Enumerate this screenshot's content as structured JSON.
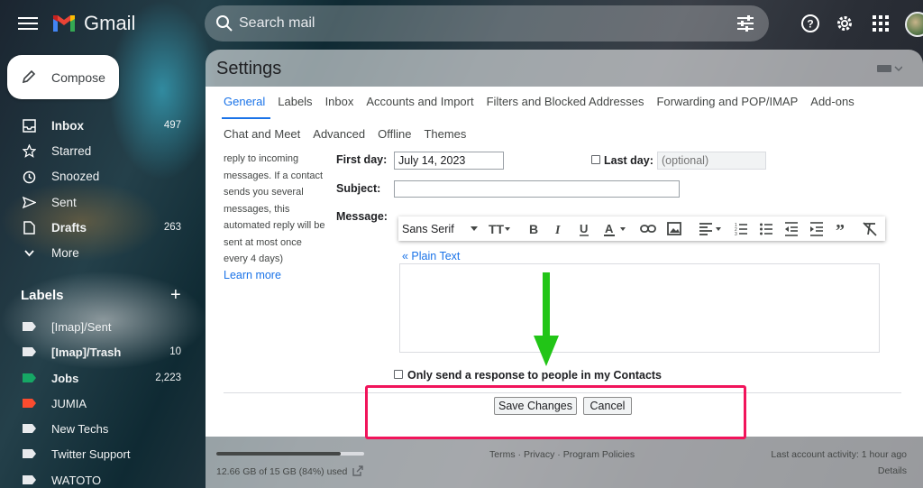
{
  "app": {
    "name": "Gmail"
  },
  "search": {
    "placeholder": "Search mail"
  },
  "compose": {
    "label": "Compose"
  },
  "nav": [
    {
      "label": "Inbox",
      "count": "497",
      "icon": "inbox-icon",
      "bold": true
    },
    {
      "label": "Starred",
      "count": "",
      "icon": "star-icon",
      "bold": false
    },
    {
      "label": "Snoozed",
      "count": "",
      "icon": "clock-icon",
      "bold": false
    },
    {
      "label": "Sent",
      "count": "",
      "icon": "send-icon",
      "bold": false
    },
    {
      "label": "Drafts",
      "count": "263",
      "icon": "draft-icon",
      "bold": true
    },
    {
      "label": "More",
      "count": "",
      "icon": "chevron-down-icon",
      "bold": false
    }
  ],
  "labels": {
    "title": "Labels",
    "items": [
      {
        "label": "[Imap]/Sent",
        "count": "",
        "color": "#e8eaed",
        "bold": false
      },
      {
        "label": "[Imap]/Trash",
        "count": "10",
        "color": "#e8eaed",
        "bold": true
      },
      {
        "label": "Jobs",
        "count": "2,223",
        "color": "#16a765",
        "bold": true
      },
      {
        "label": "JUMIA",
        "count": "",
        "color": "#fb4c2f",
        "bold": false
      },
      {
        "label": "New Techs",
        "count": "",
        "color": "#e8eaed",
        "bold": false
      },
      {
        "label": "Twitter Support",
        "count": "",
        "color": "#e8eaed",
        "bold": false
      },
      {
        "label": "WATOTO",
        "count": "",
        "color": "#e8eaed",
        "bold": false
      }
    ]
  },
  "settings": {
    "title": "Settings",
    "tabs_row1": [
      "General",
      "Labels",
      "Inbox",
      "Accounts and Import",
      "Filters and Blocked Addresses",
      "Forwarding and POP/IMAP",
      "Add-ons"
    ],
    "tabs_row2": [
      "Chat and Meet",
      "Advanced",
      "Offline",
      "Themes"
    ],
    "active_tab": "General"
  },
  "vacation": {
    "help_lines": [
      "reply to incoming",
      "messages. If a contact",
      "sends you several",
      "messages, this",
      "automated reply will be",
      "sent at most once",
      "every 4 days)"
    ],
    "learn_more": "Learn more",
    "first_day_label": "First day:",
    "first_day_value": "July 14, 2023",
    "last_day_label": "Last day:",
    "last_day_placeholder": "(optional)",
    "subject_label": "Subject:",
    "subject_value": "",
    "message_label": "Message:",
    "font_name": "Sans Serif",
    "plain_text_link": "« Plain Text",
    "contacts_only_label": "Only send a response to people in my Contacts"
  },
  "buttons": {
    "save": "Save Changes",
    "cancel": "Cancel"
  },
  "footer": {
    "storage": "12.66 GB of 15 GB (84%) used",
    "storage_fraction": 0.84,
    "terms": "Terms",
    "privacy": "Privacy",
    "program_policies": "Program Policies",
    "sep": "·",
    "last_activity": "Last account activity: 1 hour ago",
    "details": "Details"
  },
  "colors": {
    "accent": "#1a73e8",
    "highlight": "#f1145b",
    "arrow": "#22c517"
  }
}
